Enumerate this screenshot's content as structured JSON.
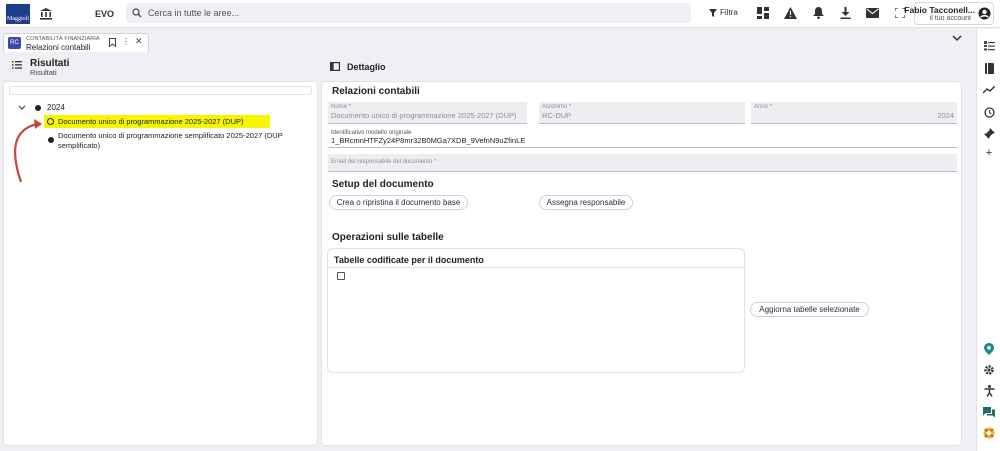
{
  "topbar": {
    "logo_text": "Maggioli",
    "app_name": "EVO",
    "search_placeholder": "Cerca in tutte le aree...",
    "filter_label": "Filtra",
    "icons": [
      "dashboard-icon",
      "warning-icon",
      "bell-icon",
      "download-icon",
      "mail-icon",
      "fullscreen-icon"
    ],
    "user": {
      "name": "Fabio Tacconell...",
      "subtitle": "il tuo account"
    }
  },
  "tab": {
    "icon_text": "RC",
    "module": "CONTABILITÀ FINANZIARIA",
    "title": "Relazioni contabili",
    "menu_glyph": "⋮",
    "close_glyph": "✕"
  },
  "left": {
    "title": "Risultati",
    "subtitle": "Risultati",
    "tree": {
      "year": "2024",
      "items": [
        {
          "label": "Documento unico di programmazione 2025-2027 (DUP)",
          "selected": true,
          "highlight": "#f6f600"
        },
        {
          "label": "Documento unico di programmazione semplificato 2025-2027 (DUP semplificato)",
          "selected": false
        }
      ]
    },
    "annotation_color": "#c9443f"
  },
  "detail": {
    "header": "Dettaglio",
    "section_title": "Relazioni contabili",
    "fields": {
      "nome": {
        "label": "Nome *",
        "value": "Documento unico di programmazione 2025-2027 (DUP)"
      },
      "acronimo": {
        "label": "Acronimo *",
        "value": "RC-DUP"
      },
      "anno": {
        "label": "Anno *",
        "value": "2024"
      },
      "identificativo": {
        "label": "Identificativo modello originale",
        "value": "1_BRcmnHTFZy24P8mr32B0MGa7XDB_9VefnN9uZfinLE"
      },
      "email": {
        "label": "Email del responsabile del documento *",
        "value": ""
      }
    },
    "setup": {
      "title": "Setup del documento",
      "btn_create": "Crea o ripristina il documento base",
      "btn_assign": "Assegna responsabile"
    },
    "operations": {
      "title": "Operazioni sulle tabelle",
      "card_title": "Tabelle codificate per il documento",
      "btn_update": "Aggiorna tabelle selezionate"
    }
  },
  "rail": {
    "top_icons": [
      "list-settings-icon",
      "book-icon",
      "trend-icon",
      "history-icon",
      "pin-icon",
      "plus-icon"
    ],
    "bottom_icons": [
      "location-icon",
      "settings-icon",
      "accessibility-icon",
      "chat-icon",
      "support-icon"
    ]
  }
}
